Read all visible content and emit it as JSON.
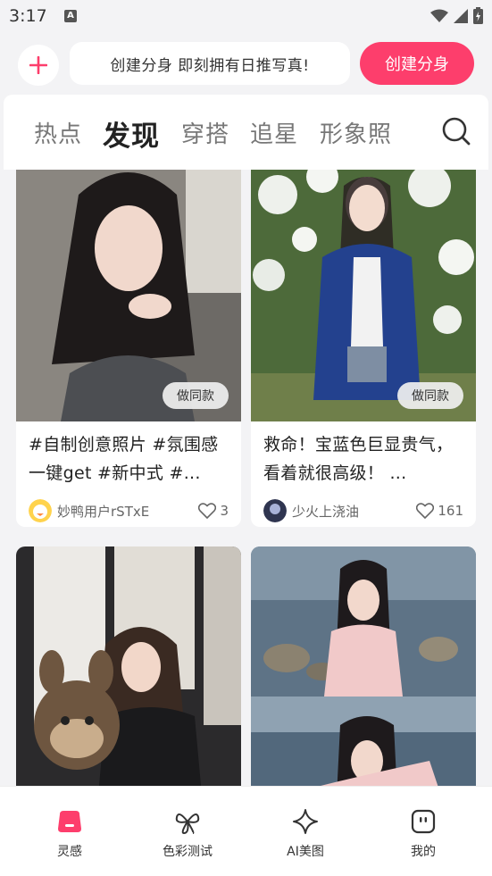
{
  "status_bar": {
    "time": "3:17",
    "notification_icon": "A",
    "icons": [
      "wifi-icon",
      "signal-icon",
      "battery-charging-icon"
    ]
  },
  "create_bar": {
    "plus_icon": "plus-icon",
    "promo_text": "创建分身 即刻拥有日推写真!",
    "create_button": "创建分身",
    "accent_color": "#fd3e6c"
  },
  "tabs": {
    "items": [
      "热点",
      "发现",
      "穿搭",
      "追星",
      "形象照"
    ],
    "active": "发现",
    "search_icon": "search-icon"
  },
  "feed": {
    "same_button_label": "做同款",
    "cards": [
      {
        "description": "#自制创意照片 #氛围感一键get #新中式 #...",
        "user": "妙鸭用户rSTxE",
        "likes": "3",
        "has_same_button": true
      },
      {
        "description": "救命！宝蓝色巨显贵气，看着就很高级！ ...",
        "user": "少火上浇油",
        "likes": "161",
        "has_same_button": true
      },
      {
        "description": "",
        "user": "",
        "likes": "",
        "has_same_button": false
      },
      {
        "description": "",
        "user": "",
        "likes": "",
        "has_same_button": false
      }
    ]
  },
  "bottom_nav": {
    "items": [
      {
        "label": "灵感",
        "icon": "inspiration-icon",
        "active": true
      },
      {
        "label": "色彩测试",
        "icon": "color-test-icon",
        "active": false
      },
      {
        "label": "AI美图",
        "icon": "sparkle-icon",
        "active": false
      },
      {
        "label": "我的",
        "icon": "profile-icon",
        "active": false
      }
    ]
  }
}
